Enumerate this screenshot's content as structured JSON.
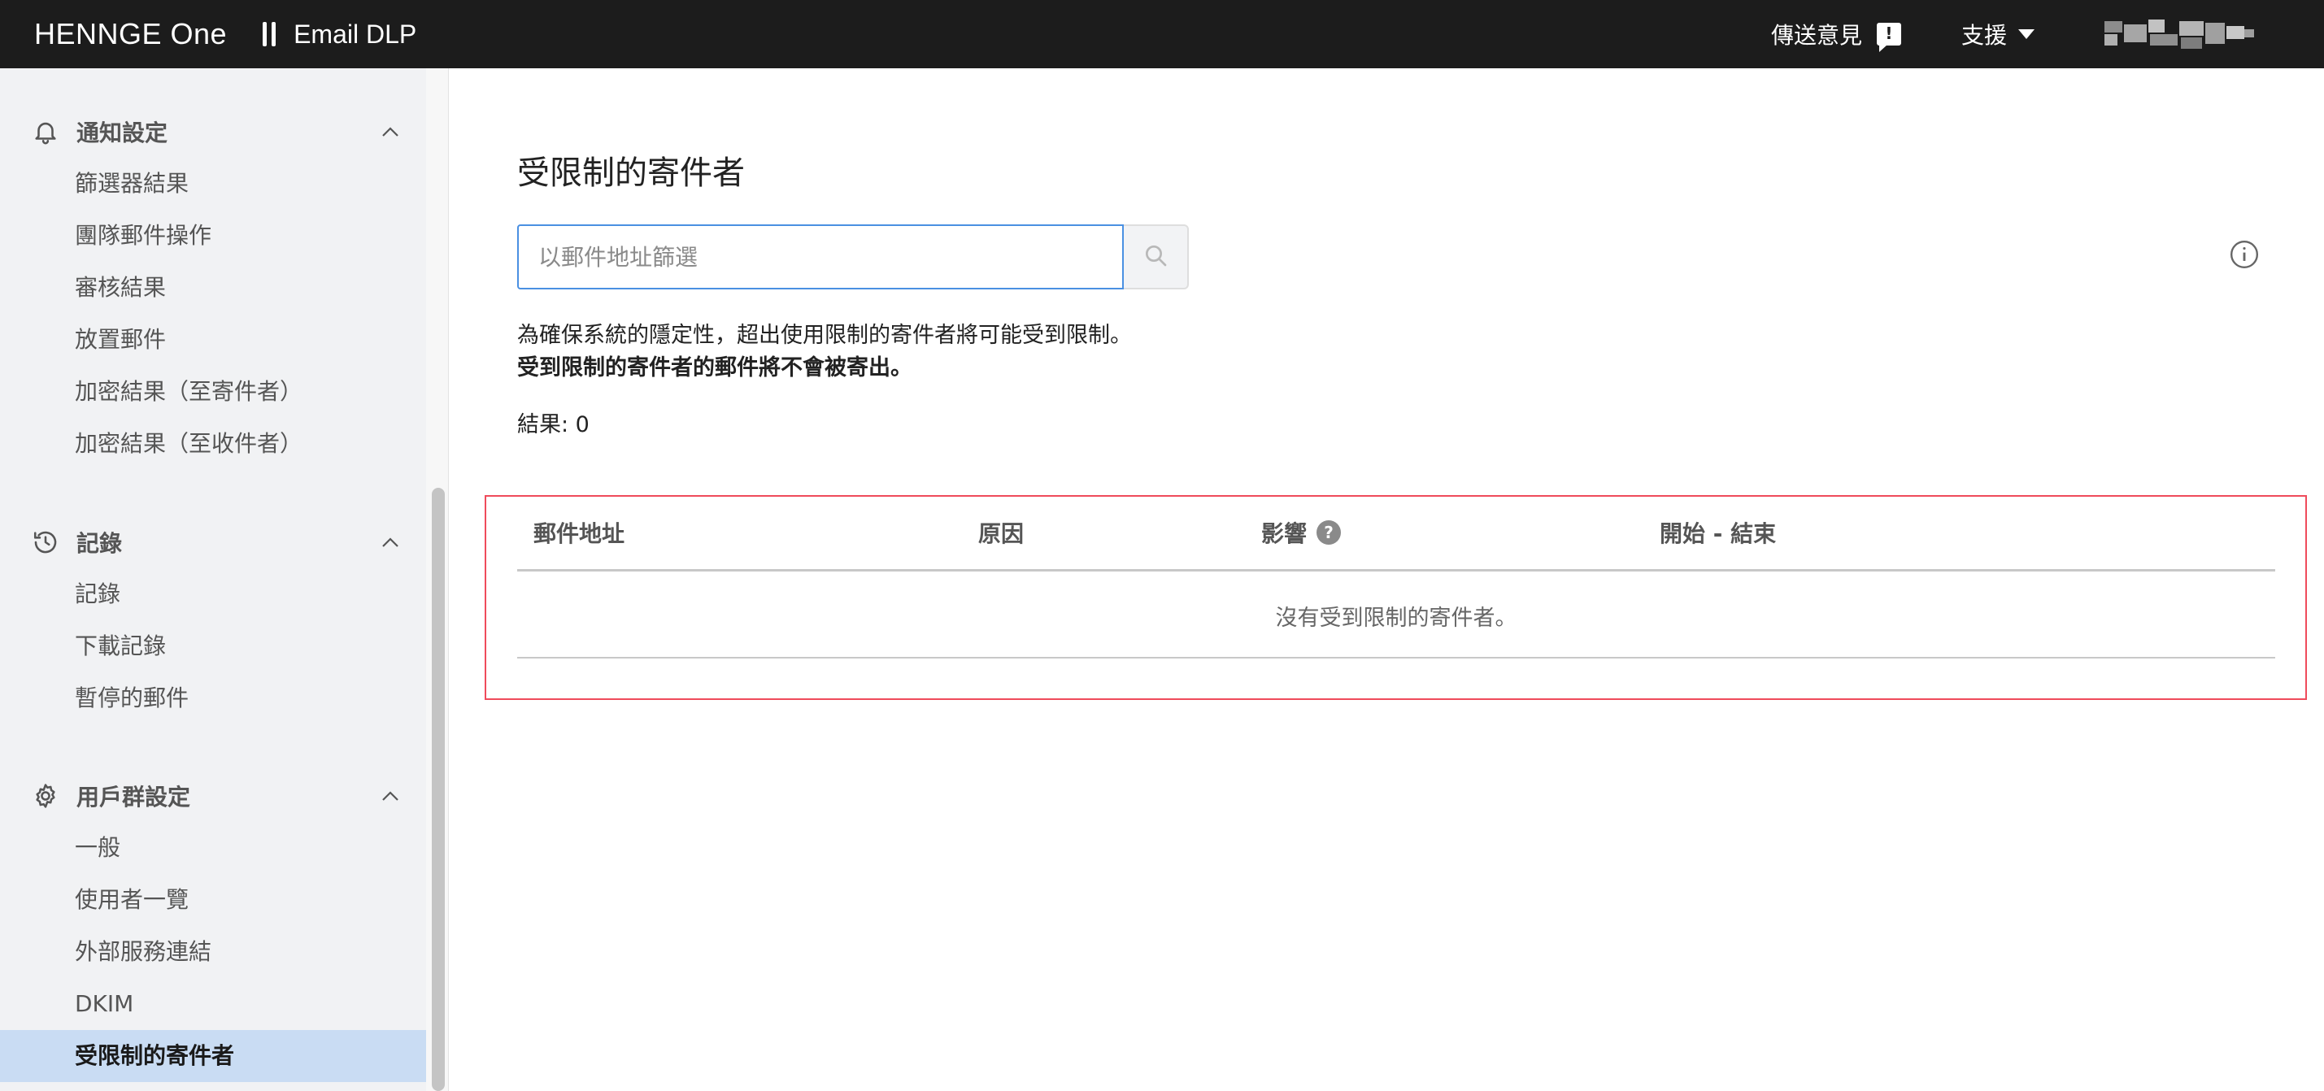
{
  "topbar": {
    "brand": "HENNGE One",
    "product": "Email DLP",
    "feedback_label": "傳送意見",
    "feedback_icon": "feedback-icon",
    "support_label": "支援",
    "colors": {
      "background": "#1c1c1c",
      "text": "#ffffff"
    }
  },
  "sidebar": {
    "sections": [
      {
        "title": "通知設定",
        "icon": "bell-icon",
        "expanded": true,
        "items": [
          "篩選器結果",
          "團隊郵件操作",
          "審核結果",
          "放置郵件",
          "加密結果（至寄件者）",
          "加密結果（至收件者）"
        ]
      },
      {
        "title": "記錄",
        "icon": "history-icon",
        "expanded": true,
        "items": [
          "記錄",
          "下載記錄",
          "暫停的郵件"
        ]
      },
      {
        "title": "用戶群設定",
        "icon": "gear-icon",
        "expanded": true,
        "items": [
          "一般",
          "使用者一覽",
          "外部服務連結",
          "DKIM",
          "受限制的寄件者"
        ]
      }
    ],
    "active_item": "受限制的寄件者",
    "colors": {
      "background": "#f1f2f4",
      "active": "#c9dcf3"
    }
  },
  "main": {
    "title": "受限制的寄件者",
    "search": {
      "placeholder": "以郵件地址篩選",
      "value": ""
    },
    "notice_line1": "為確保系統的隱定性，超出使用限制的寄件者將可能受到限制。",
    "notice_line2": "受到限制的寄件者的郵件將不會被寄出。",
    "result_count": "結果: 0",
    "table": {
      "columns": [
        "郵件地址",
        "原因",
        "影響",
        "開始 - 結束"
      ],
      "empty_message": "沒有受到限制的寄件者。"
    },
    "colors": {
      "search_border": "#4a90e2",
      "table_highlight": "#ef4b5b"
    }
  }
}
